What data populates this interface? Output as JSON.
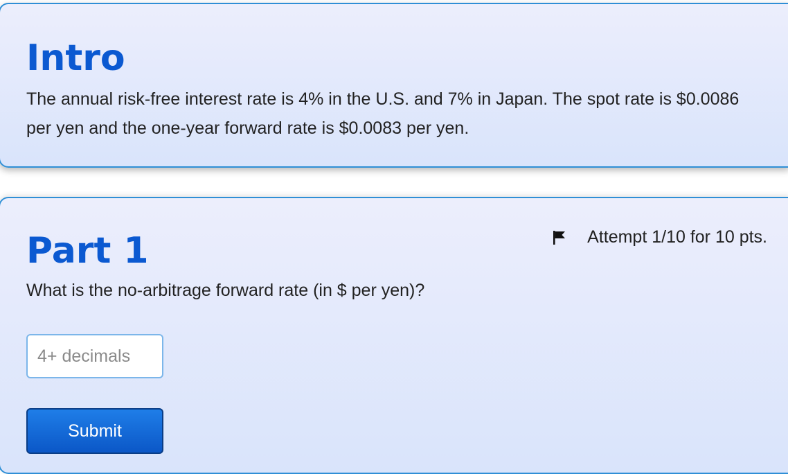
{
  "intro": {
    "title": "Intro",
    "text": "The annual risk-free interest rate is 4% in the U.S. and 7% in Japan. The spot rate is $0.0086 per yen and the one-year forward rate is $0.0083 per yen."
  },
  "part1": {
    "title": "Part 1",
    "attempt": "Attempt 1/10 for 10 pts.",
    "flag_icon": "flag-icon",
    "question": "What is the no-arbitrage forward rate (in $ per yen)?",
    "input": {
      "value": "",
      "placeholder": "4+ decimals"
    },
    "submit_label": "Submit"
  },
  "colors": {
    "heading": "#0b59d1",
    "card_border": "#2f8fd6",
    "button": "#0b57c7"
  }
}
